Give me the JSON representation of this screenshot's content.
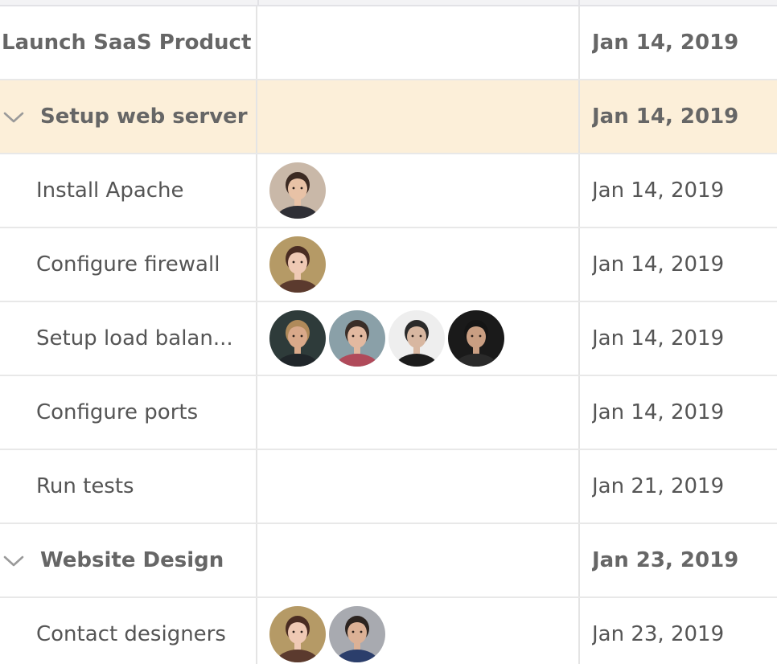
{
  "rows": [
    {
      "id": "r0",
      "kind": "project",
      "name": "Launch SaaS Product",
      "date": "Jan 14, 2019",
      "avatars": []
    },
    {
      "id": "r1",
      "kind": "group",
      "name": "Setup web server",
      "date": "Jan 14, 2019",
      "avatars": [],
      "expanded": true,
      "selected": true
    },
    {
      "id": "r2",
      "kind": "task",
      "name": "Install Apache",
      "date": "Jan 14, 2019",
      "avatars": [
        "woman-brown-hair"
      ]
    },
    {
      "id": "r3",
      "kind": "task",
      "name": "Configure firewall",
      "date": "Jan 14, 2019",
      "avatars": [
        "woman-long-hair"
      ]
    },
    {
      "id": "r4",
      "kind": "task",
      "name": "Setup load balan...",
      "date": "Jan 14, 2019",
      "avatars": [
        "man-blond-beard",
        "man-dark-hair",
        "man-pixelated",
        "man-glasses"
      ]
    },
    {
      "id": "r5",
      "kind": "task",
      "name": "Configure ports",
      "date": "Jan 14, 2019",
      "avatars": []
    },
    {
      "id": "r6",
      "kind": "task",
      "name": "Run tests",
      "date": "Jan 21, 2019",
      "avatars": []
    },
    {
      "id": "r7",
      "kind": "group",
      "name": "Website Design",
      "date": "Jan 23, 2019",
      "avatars": [],
      "expanded": true
    },
    {
      "id": "r8",
      "kind": "task",
      "name": "Contact designers",
      "date": "Jan 23, 2019",
      "avatars": [
        "woman-long-hair",
        "man-plaid-shirt"
      ]
    }
  ],
  "colors": {
    "selected_row": "#fcefd9",
    "grid_line": "#e4e4e4",
    "text": "#555555",
    "chevron": "#9a9a9a"
  }
}
